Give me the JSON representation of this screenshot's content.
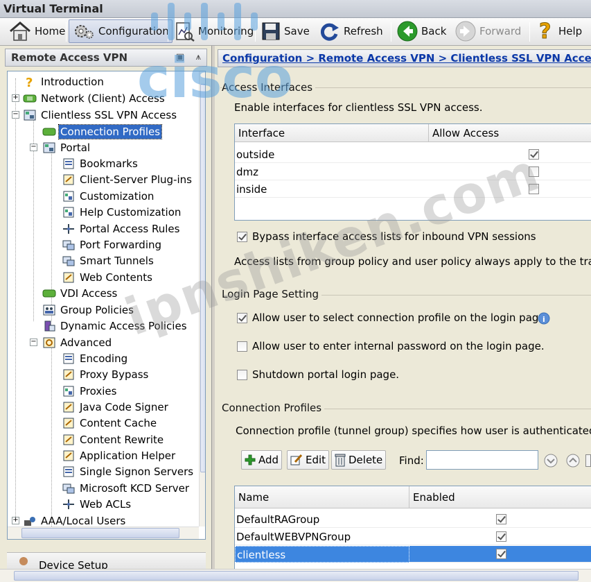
{
  "window": {
    "title": "Virtual Terminal"
  },
  "toolbar": {
    "home": "Home",
    "configuration": "Configuration",
    "monitoring": "Monitoring",
    "save": "Save",
    "refresh": "Refresh",
    "back": "Back",
    "forward": "Forward",
    "help": "Help"
  },
  "left_panel": {
    "title": "Remote Access VPN",
    "tree": {
      "introduction": "Introduction",
      "network_client_access": "Network (Client) Access",
      "clientless_ssl_vpn_access": "Clientless SSL VPN Access",
      "connection_profiles": "Connection Profiles",
      "portal": "Portal",
      "bookmarks": "Bookmarks",
      "client_server_plugins": "Client-Server Plug-ins",
      "customization": "Customization",
      "help_customization": "Help Customization",
      "portal_access_rules": "Portal Access Rules",
      "port_forwarding": "Port Forwarding",
      "smart_tunnels": "Smart Tunnels",
      "web_contents": "Web Contents",
      "vdi_access": "VDI Access",
      "group_policies": "Group Policies",
      "dynamic_access_policies": "Dynamic Access Policies",
      "advanced": "Advanced",
      "encoding": "Encoding",
      "proxy_bypass": "Proxy Bypass",
      "proxies": "Proxies",
      "java_code_signer": "Java Code Signer",
      "content_cache": "Content Cache",
      "content_rewrite": "Content Rewrite",
      "application_helper": "Application Helper",
      "single_signon_servers": "Single Signon Servers",
      "microsoft_kcd_server": "Microsoft KCD Server",
      "web_acls": "Web ACLs",
      "aaa_local_users": "AAA/Local Users"
    },
    "device_setup": "Device Setup"
  },
  "breadcrumb": {
    "text": "Configuration > Remote Access VPN > Clientless SSL VPN Access"
  },
  "access_interfaces": {
    "title": "Access Interfaces",
    "description": "Enable interfaces for clientless SSL VPN access.",
    "columns": {
      "interface": "Interface",
      "allow_access": "Allow Access"
    },
    "rows": [
      {
        "interface": "outside",
        "allow": true
      },
      {
        "interface": "dmz",
        "allow": false
      },
      {
        "interface": "inside",
        "allow": false
      }
    ],
    "bypass_label": "Bypass interface access lists for inbound VPN sessions",
    "bypass_checked": true,
    "note": "Access lists from group policy and user policy always apply to the traffic."
  },
  "login_page": {
    "title": "Login Page Setting",
    "allow_select_label": "Allow user to select connection profile on the login page.",
    "allow_select_checked": true,
    "allow_password_label": "Allow user to enter internal password on the login page.",
    "allow_password_checked": false,
    "shutdown_label": "Shutdown portal login page.",
    "shutdown_checked": false
  },
  "connection_profiles": {
    "title": "Connection Profiles",
    "description": "Connection profile (tunnel group) specifies how user is authenticated and",
    "add": "Add",
    "edit": "Edit",
    "delete": "Delete",
    "find_label": "Find:",
    "find_value": "",
    "columns": {
      "name": "Name",
      "enabled": "Enabled"
    },
    "rows": [
      {
        "name": "DefaultRAGroup",
        "enabled": true
      },
      {
        "name": "DefaultWEBVPNGroup",
        "enabled": true
      },
      {
        "name": "clientless",
        "enabled": true
      }
    ]
  },
  "watermark": {
    "logo": "cisco",
    "text": "ipnshiken.com"
  },
  "colors": {
    "selection": "#316ac5",
    "row_selection": "#3d86e0",
    "link": "#0b38a8"
  }
}
